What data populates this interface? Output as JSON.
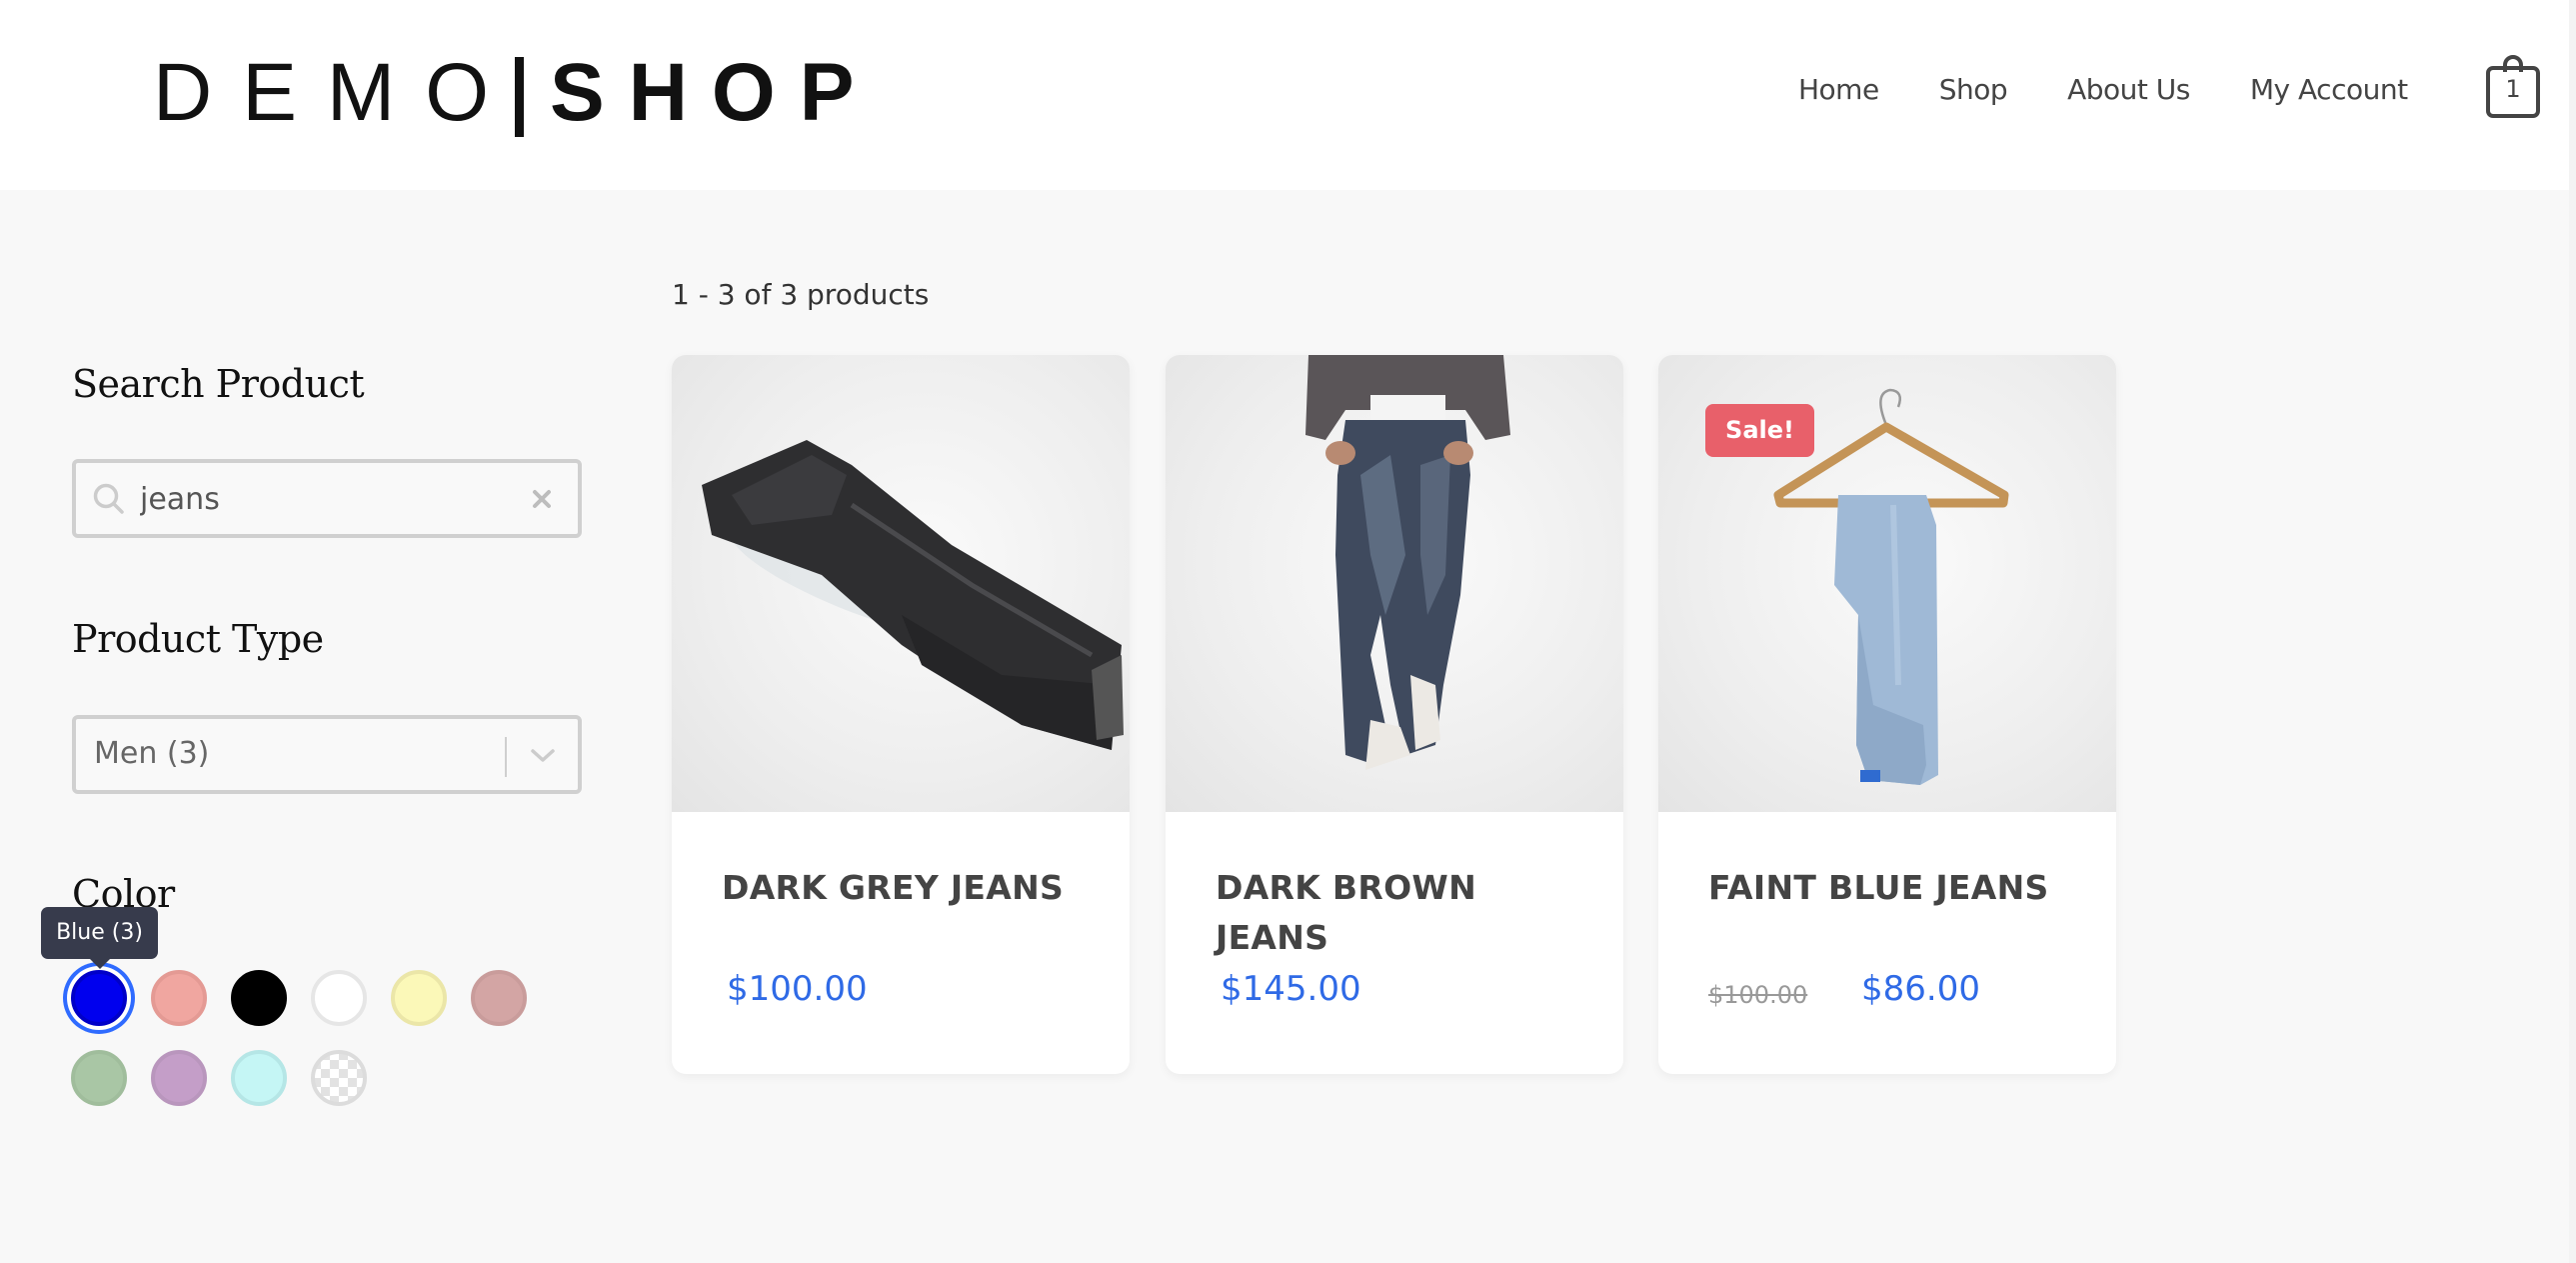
{
  "header": {
    "logo": {
      "left": "DEMO",
      "right": "SHOP"
    },
    "nav": [
      {
        "label": "Home"
      },
      {
        "label": "Shop"
      },
      {
        "label": "About Us"
      },
      {
        "label": "My Account"
      }
    ],
    "cart": {
      "icon": "shopping-bag-icon",
      "count": "1"
    }
  },
  "sidebar": {
    "search": {
      "heading": "Search Product",
      "value": "jeans",
      "placeholder": "",
      "search_icon": "search-icon",
      "clear_icon": "close-icon"
    },
    "product_type": {
      "heading": "Product Type",
      "selected": "Men (3)",
      "chevron_icon": "chevron-down-icon"
    },
    "color": {
      "heading": "Color",
      "tooltip": "Blue (3)",
      "swatches": [
        {
          "name": "Blue",
          "color": "#0000ee",
          "border": "#0000c8",
          "selected": true
        },
        {
          "name": "Pink",
          "color": "#f0a6a0",
          "border": "#e49a94",
          "selected": false
        },
        {
          "name": "Black",
          "color": "#000000",
          "border": "#000000",
          "selected": false
        },
        {
          "name": "White",
          "color": "#ffffff",
          "border": "#e6e6e6",
          "selected": false
        },
        {
          "name": "Yellow",
          "color": "#fbf8b8",
          "border": "#ebe6a8",
          "selected": false
        },
        {
          "name": "Rose",
          "color": "#d3a5a4",
          "border": "#c99c9b",
          "selected": false
        },
        {
          "name": "Green",
          "color": "#a9c6a5",
          "border": "#a0bd9c",
          "selected": false
        },
        {
          "name": "Purple",
          "color": "#c49ec8",
          "border": "#b996bd",
          "selected": false
        },
        {
          "name": "Cyan",
          "color": "#c5f6f5",
          "border": "#b5e6e6",
          "selected": false
        },
        {
          "name": "Transparent",
          "color": "transparent",
          "border": "#dcdcdc",
          "selected": false
        }
      ]
    }
  },
  "main": {
    "result_count": "1 - 3 of 3 products",
    "products": [
      {
        "title": "DARK GREY JEANS",
        "price": "$100.00",
        "image": "dark-grey-jeans-image"
      },
      {
        "title": "DARK BROWN JEANS",
        "price": "$145.00",
        "image": "dark-brown-jeans-image"
      },
      {
        "title": "FAINT BLUE JEANS",
        "old_price": "$100.00",
        "price": "$86.00",
        "badge": "Sale!",
        "image": "faint-blue-jeans-image"
      }
    ]
  },
  "colors": {
    "accent_price": "#2f6ae6",
    "sale_badge": "#e8606a",
    "tooltip_bg": "#373b4c",
    "selected_ring": "#2f6bff"
  }
}
